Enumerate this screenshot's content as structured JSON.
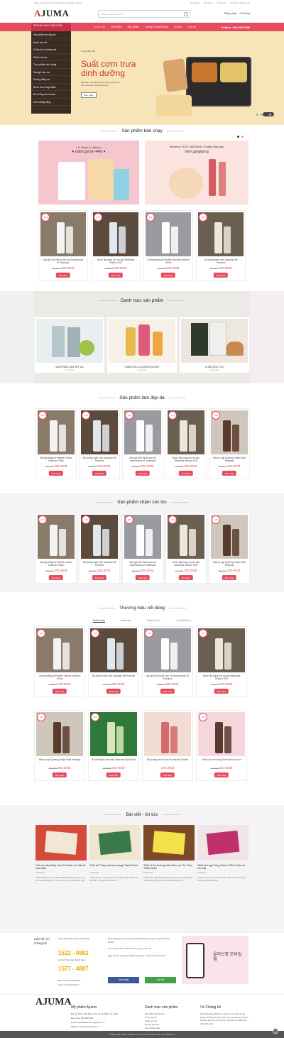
{
  "topbar": {
    "welcome": "Chào mừng bạn đến với hệ thống mỹ phẩm ajuma",
    "links": [
      "Giới thiệu",
      "Giỏ hàng",
      "Tài khoản",
      "Thông tin thanh toán"
    ]
  },
  "header": {
    "logo_a": "A",
    "logo_rest": "JUMA",
    "search_placeholder": "Nhập từ khóa tìm kiếm...",
    "login": "Đăng nhập",
    "cart": "Giỏ hàng"
  },
  "nav": {
    "category_label": "DANH MỤC SẢN PHẨM",
    "links": [
      "Trang chủ",
      "Giới thiệu",
      "Sản phẩm",
      "Thông tin thanh toán",
      "Tin tức",
      "Liên hệ"
    ],
    "hotline": "Hotline: 094.999.9295"
  },
  "sidebar": [
    "Sản phẩm làm đẹp da",
    "Nước hoa nữ",
    "Chăm sóc & dưỡng da",
    "Chăm sóc tóc",
    "Thực phẩm chức năng",
    "Dầu gội mọc tóc",
    "Dưỡng trắng da",
    "Nước hoa hồng Melde",
    "Bộ dưỡng da trà xanh",
    "Kem chống nắng"
  ],
  "hero": {
    "kicker": "3 ngày đầy chất",
    "title": "Suất cơm trưa dinh dưỡng",
    "desc": "Bảo đảm dinh dưỡng và năng lượng cho bữa trưa văn phòng của bạn.",
    "button": "Xem ngay"
  },
  "bestseller": {
    "title": "Sản phẩm bán chạy",
    "promo1": {
      "line1": "LG Sirius & Unicorn",
      "line2": "♥ Giảm giá tới 44% ♥"
    },
    "promo2": {
      "line1": "Blieberry / 3CE / NIBRAND / Gelato Nhà máy",
      "line2": "nhìn gangbang"
    },
    "products": [
      {
        "pct": "-13%",
        "name": "Dầu gội kích thích mọc tóc Kaminomoto M. Shampoo",
        "old": "350.000đ",
        "price": "300.000đ",
        "buy": "Mua hàng"
      },
      {
        "pct": "-17%",
        "name": "Nước tẩy trang cho da dầu Bioderma Sebium H2O",
        "old": "240.000đ",
        "price": "200.000đ",
        "buy": "Mua hàng"
      },
      {
        "pct": "-13%",
        "name": "Dưỡng trắng da Peptide Volume Essence 100ml",
        "old": "260.000đ",
        "price": "230.000đ",
        "buy": "Mua hàng"
      },
      {
        "pct": "-11%",
        "name": "Bộ dưỡng thảo mộc Daandan Bit Premium",
        "old": "280.000đ",
        "price": "250.000đ",
        "buy": "Mua hàng"
      }
    ]
  },
  "categories": {
    "title": "Danh mục sản phẩm",
    "items": [
      {
        "name": "SẢN PHẨM LÀM ĐẸP DA",
        "count": "1 sản phẩm"
      },
      {
        "name": "CHĂM SÓC & DƯỠNG DA MẶT",
        "count": "1 sản phẩm"
      },
      {
        "name": "CHĂM SÓC TÓC",
        "count": "1 sản phẩm"
      }
    ]
  },
  "beauty": {
    "title": "Sản phẩm làm đẹp da",
    "products": [
      {
        "pct": "-12%",
        "name": "Dưỡng trắng da Peptide Volume Essence 100ml",
        "old": "260.000đ",
        "price": "230.000đ",
        "buy": "Mua hàng"
      },
      {
        "pct": "-11%",
        "name": "Bộ dưỡng thảo mộc Daandan Bit Premium",
        "old": "280.000đ",
        "price": "250.000đ",
        "buy": "Mua hàng"
      },
      {
        "pct": "-13%",
        "name": "Dầu gội kích thích mọc tóc Kaminomoto M. Shampoo",
        "old": "350.000đ",
        "price": "300.000đ",
        "buy": "Mua hàng"
      },
      {
        "pct": "-17%",
        "name": "Nước tẩy trang cho da dầu Bioderma Sebium H2O",
        "old": "240.000đ",
        "price": "200.000đ",
        "buy": "Mua hàng"
      },
      {
        "pct": "-12%",
        "name": "Mặt nạ ngủ Queeng Omija Snail Sleeping",
        "old": "280.000đ",
        "price": "250.000đ",
        "buy": "Mua hàng"
      }
    ]
  },
  "hair": {
    "title": "Sản phẩm chăm sóc tóc",
    "products": [
      {
        "pct": "-12%",
        "name": "Dưỡng trắng da Peptide Volume Essence 100ml",
        "old": "260.000đ",
        "price": "230.000đ",
        "buy": "Mua hàng"
      },
      {
        "pct": "-11%",
        "name": "Bộ dưỡng thảo mộc Daandan Bit Premium",
        "old": "280.000đ",
        "price": "250.000đ",
        "buy": "Mua hàng"
      },
      {
        "pct": "-13%",
        "name": "Dầu gội kích thích mọc tóc Kaminomoto M. Shampoo",
        "old": "350.000đ",
        "price": "300.000đ",
        "buy": "Mua hàng"
      },
      {
        "pct": "-17%",
        "name": "Nước tẩy trang cho da dầu Bioderma Sebium H2O",
        "old": "240.000đ",
        "price": "200.000đ",
        "buy": "Mua hàng"
      },
      {
        "pct": "-12%",
        "name": "Mặt nạ ngủ Queeng Omija Snail Sleeping",
        "old": "280.000đ",
        "price": "250.000đ",
        "buy": "Mua hàng"
      }
    ]
  },
  "brands": {
    "title": "Thương hiệu nổi tiếng",
    "tabs": [
      "BioDermas",
      "Hadarabo",
      "Natural Care",
      "Jenny Bakery"
    ],
    "products": [
      {
        "pct": "-12%",
        "name": "Dưỡng trắng da Peptide Volume Essence 100ml",
        "old": "260.000đ",
        "price": "230.000đ",
        "buy": "Mua hàng"
      },
      {
        "pct": "-11%",
        "name": "Bộ dưỡng thảo mộc Daandan Bit Premium",
        "old": "280.000đ",
        "price": "250.000đ",
        "buy": "Mua hàng"
      },
      {
        "pct": "-13%",
        "name": "Dầu gội kích thích mọc tóc Kaminomoto M. Shampoo",
        "old": "350.000đ",
        "price": "300.000đ",
        "buy": "Mua hàng"
      },
      {
        "pct": "-17%",
        "name": "Nước tẩy trang cho da dầu Bioderma Sebium H2O",
        "old": "240.000đ",
        "price": "200.000đ",
        "buy": "Mua hàng"
      },
      {
        "pct": "-12%",
        "name": "Mặt nạ ngủ Queeng Omija Snail Sleeping",
        "old": "280.000đ",
        "price": "250.000đ",
        "buy": "Mua hàng"
      },
      {
        "pct": "-13%",
        "name": "Bộ dưỡng da trà xanh Green tea Special kit",
        "old": "230.000đ",
        "price": "200.000đ",
        "buy": "Mua hàng"
      },
      {
        "pct": "",
        "name": "Bộ dưỡng da cà chua Foodaholic Tomato",
        "old": "",
        "price": "200.000đ",
        "buy": "Mua hàng"
      },
      {
        "pct": "-12%",
        "name": "Nước hoa nữ hồng Dionel Secret Love",
        "old": "240.000đ",
        "price": "210.000đ",
        "buy": "Mua hàng"
      }
    ]
  },
  "news": {
    "title": "Bài viết - tin tức",
    "items": [
      {
        "title": "Chia sẻ mẫu thiệp chúc Tết dành cho Nữ sở mạo năm",
        "date": "13/06/2018",
        "excerpt": "Chào các bạn, cùa Tết Mậu Tuất 2018 sắp đến gần, Thì sao một nghệ thiệp in Trình nhường cho mẫu thiệp năm ..."
      },
      {
        "title": "Thiết kế Thiệp mời bốn mạng Thành Giuse",
        "date": "13/06/2018",
        "excerpt": "Chào các bạn, qua thiệp mời Tết nguyên đán Mậu Tuất 2018 đó, mọi người biết rồi đó..."
      },
      {
        "title": "Thiết kế bộ thương hiệu Mầm non Tư Thục Thiên Nhân",
        "date": "13/06/2018",
        "excerpt": "Thiết kế bộ nhận diện thương hiệu là một phương pháp thể hiện thương hiệu thuộc phẩm chất lượng..."
      },
      {
        "title": "Thiết kế Logo Công Giáo Lễ Sinh Giáo xứ Gò Vấp",
        "date": "13/06/2018",
        "excerpt": "Chào các bạn, tuần vừa rồi mình nhận làm một lúc gần chục công thiết kế logo..."
      }
    ]
  },
  "contact": {
    "label": "Liên hệ với chúng tôi",
    "support": "Trung tâm Khách hàng Online Mail:",
    "phone1": "1522 - 0882",
    "trung": "Liên trở Trung tâm khách hàng",
    "phone2": "1577 - 4887",
    "addr": "Điện thoại: 094.999.9295",
    "email": "Email: hotro@web24.vn",
    "hours": "Giờ hoạt động của Trung tâm Khách hàng [Các ngày trong tuần 09:00 - 18:00]",
    "note1": "Từ trung tâm hỗ trợ được mở lúc 1 giờ chiều nay.",
    "note2": "Ngay sau khi chúng tôi bắt đầu công việc, chúng tôi sẽ trả lời bạn.",
    "btn1": "Xem ngay",
    "btn2": "Liên hệ",
    "app": "올리브영 모바일 앱"
  },
  "footer": {
    "logo": "AJUMA",
    "col1_title": "Mỹ phẩm Ajuma",
    "col1": [
      "Địa chỉ: Phạm Văn Bạch, P.15, Q.Tân Bình, Tp. HCM",
      "Điện thoại: 094.999.9295",
      "Email: bfowebsiteshop.vn@gmail.com",
      "Website: https://www.web24.vn"
    ],
    "col2_title": "Danh mục sản phẩm",
    "col2": [
      "Sản phẩm làm đẹp da",
      "Nước hoa nữ",
      "Chăm sóc tóc",
      "Dưỡng trắng da",
      "Kem chống nắng"
    ],
    "col3_title": "Về Chúng tôi",
    "col3": "Mỹ phẩm Ajuma là đơn vị chuyên cung cấp các mỹ phẩm làm đẹp của Hàn Quốc, với mục tiêu đem lại làn da khỏe đẹp cho mọi phụ nữ Việt Nam trên khắp mọi miền đất nước.",
    "copyright": "© Bản quyền thuộc về Bến Tentt | Thiết kế và phát triển bởi Web24.vn"
  },
  "colors": {
    "accent": "#e84a5f",
    "dark_brown": "#3a2b23",
    "hero_bg": "#f7e4b8"
  }
}
